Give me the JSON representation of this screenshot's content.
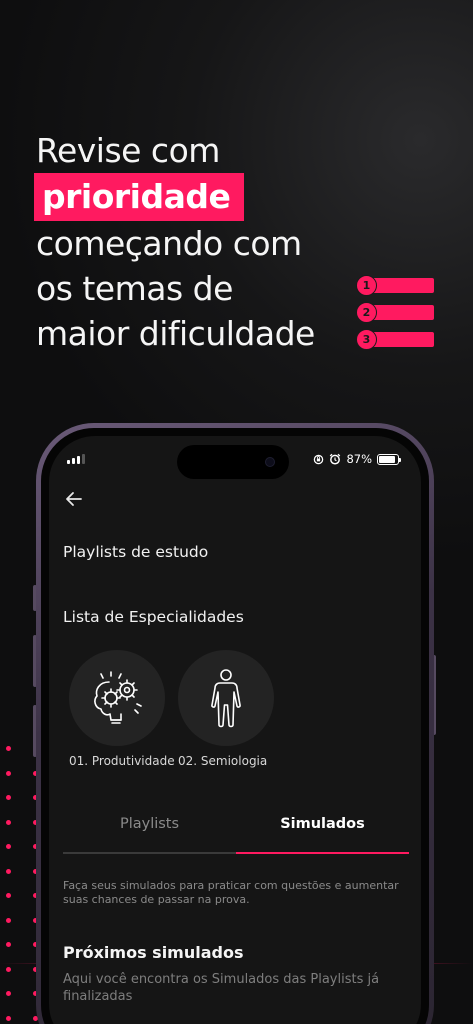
{
  "promo": {
    "line1": "Revise com",
    "highlight": "prioridade",
    "line3": "começando com",
    "line4": "os temas de",
    "line5": "maior dificuldade",
    "ranks": [
      "1",
      "2",
      "3"
    ],
    "accent_color": "#ff1a60"
  },
  "status_bar": {
    "battery": "87%",
    "battery_level": 0.87,
    "icons": [
      "signal-icon",
      "rotation-lock-icon",
      "alarm-icon",
      "battery-icon"
    ]
  },
  "screen": {
    "back_icon": "arrow-left-icon",
    "playlists_title": "Playlists de estudo",
    "specialties_title": "Lista de Especialidades",
    "specialties": [
      {
        "label": "01. Produtividade",
        "icon": "brain-gears-icon"
      },
      {
        "label": "02. Semiologia",
        "icon": "human-body-icon"
      }
    ],
    "tabs": [
      {
        "label": "Playlists",
        "active": false
      },
      {
        "label": "Simulados",
        "active": true
      }
    ],
    "simulados_description": "Faça seus simulados para praticar com questões e aumentar suas chances de passar na prova.",
    "next_simulados_title": "Próximos simulados",
    "next_simulados_description": "Aqui você encontra os Simulados das Playlists já finalizadas"
  }
}
